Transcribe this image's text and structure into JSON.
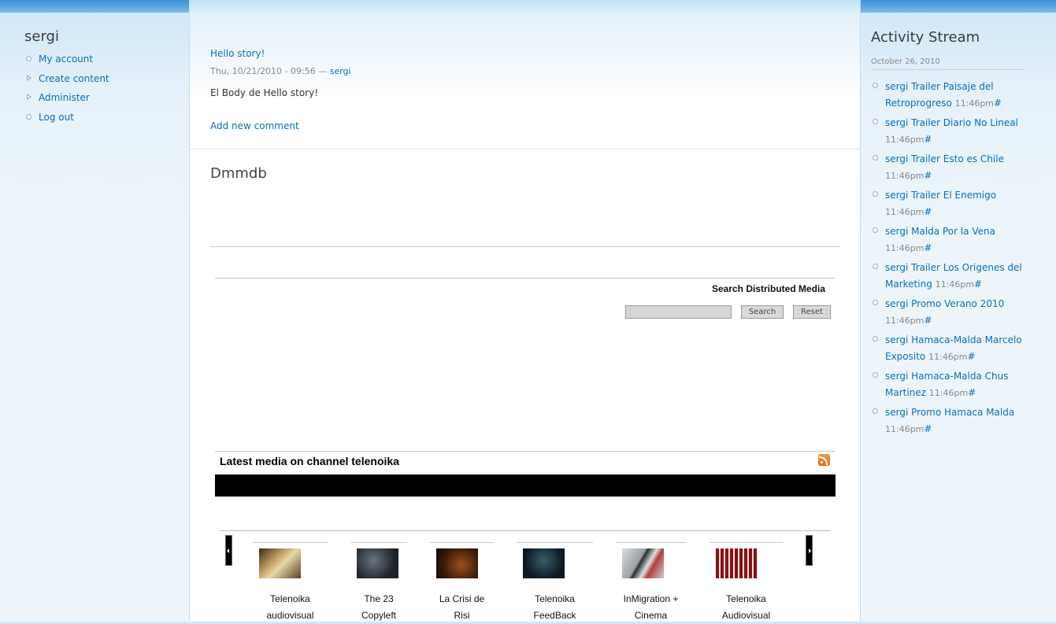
{
  "left_sidebar": {
    "user": "sergi",
    "menu": [
      "My account",
      "Create content",
      "Administer",
      "Log out"
    ]
  },
  "node": {
    "title": "Hello story!",
    "meta": "Thu, 10/21/2010 - 09:56 —",
    "author": "sergi",
    "body": "El Body de Hello story!",
    "comment_link": "Add new comment"
  },
  "dmmdb": {
    "title": "Dmmdb",
    "search_title": "Search Distributed Media",
    "search_button": "Search",
    "reset_button": "Reset",
    "latest_title": "Latest media on channel telenoika"
  },
  "carousel": {
    "items": [
      {
        "line1": "Telenoika",
        "line2": "audiovisual"
      },
      {
        "line1": "The 23",
        "line2": "Copyleft"
      },
      {
        "line1": "La Crisi de",
        "line2": "Risi"
      },
      {
        "line1": "Telenoika",
        "line2": "FeedBack"
      },
      {
        "line1": "InMigration +",
        "line2": "Cinema"
      },
      {
        "line1": "Telenoika",
        "line2": "Audiovisual"
      }
    ]
  },
  "activity": {
    "title": "Activity Stream",
    "date": "October 26, 2010",
    "items": [
      {
        "text": "sergi Trailer Paisaje del Retroprogreso",
        "time": "11:46pm",
        "hash": "#"
      },
      {
        "text": "sergi Trailer Diario No Lineal",
        "time": "11:46pm",
        "hash": "#"
      },
      {
        "text": "sergi Trailer Esto es Chile",
        "time": "11:46pm",
        "hash": "#"
      },
      {
        "text": "sergi Trailer El Enemigo",
        "time": "11:46pm",
        "hash": "#"
      },
      {
        "text": "sergi Malda Por la Vena",
        "time": "11:46pm",
        "hash": "#"
      },
      {
        "text": "sergi Trailer Los Origenes del Marketing",
        "time": "11:46pm",
        "hash": "#"
      },
      {
        "text": "sergi Promo Verano 2010",
        "time": "11:46pm",
        "hash": "#"
      },
      {
        "text": "sergi Hamaca-Malda Marcelo Exposito",
        "time": "11:46pm",
        "hash": "#"
      },
      {
        "text": "sergi Hamaca-Malda Chus Martinez",
        "time": "11:46pm",
        "hash": "#"
      },
      {
        "text": "sergi Promo Hamaca Malda",
        "time": "11:46pm",
        "hash": "#"
      }
    ]
  },
  "colors": {
    "link": "#0a6fb8",
    "top_bar": "#3b90d6"
  }
}
